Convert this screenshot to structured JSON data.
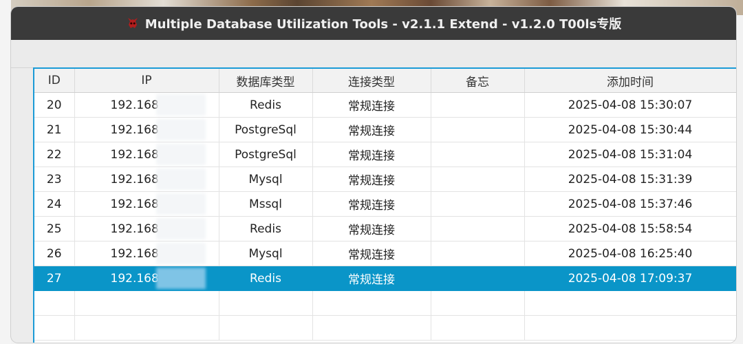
{
  "window": {
    "title": "Multiple Database Utilization Tools - v2.1.1 Extend - v1.2.0 T00ls专版",
    "logo_icon": "red-demon-skull-icon"
  },
  "table": {
    "columns": [
      "ID",
      "IP",
      "数据库类型",
      "连接类型",
      "备忘",
      "添加时间"
    ],
    "rows": [
      {
        "id": "20",
        "ip": "192.168",
        "db_type": "Redis",
        "conn_type": "常规连接",
        "memo": "",
        "time": "2025-04-08 15:30:07"
      },
      {
        "id": "21",
        "ip": "192.168",
        "db_type": "PostgreSql",
        "conn_type": "常规连接",
        "memo": "",
        "time": "2025-04-08 15:30:44"
      },
      {
        "id": "22",
        "ip": "192.168",
        "db_type": "PostgreSql",
        "conn_type": "常规连接",
        "memo": "",
        "time": "2025-04-08 15:31:04"
      },
      {
        "id": "23",
        "ip": "192.168.",
        "db_type": "Mysql",
        "conn_type": "常规连接",
        "memo": "",
        "time": "2025-04-08 15:31:39"
      },
      {
        "id": "24",
        "ip": "192.168",
        "db_type": "Mssql",
        "conn_type": "常规连接",
        "memo": "",
        "time": "2025-04-08 15:37:46"
      },
      {
        "id": "25",
        "ip": "192.168",
        "db_type": "Redis",
        "conn_type": "常规连接",
        "memo": "",
        "time": "2025-04-08 15:58:54"
      },
      {
        "id": "26",
        "ip": "192.168",
        "db_type": "Mysql",
        "conn_type": "常规连接",
        "memo": "",
        "time": "2025-04-08 16:25:40"
      },
      {
        "id": "27",
        "ip": "192.168",
        "db_type": "Redis",
        "conn_type": "常规连接",
        "memo": "",
        "time": "2025-04-08 17:09:37"
      }
    ],
    "selected_id": "27"
  },
  "colors": {
    "titlebar": "#3a3a3a",
    "selection": "#0a95c8",
    "focus_border": "#1a9ad6"
  }
}
